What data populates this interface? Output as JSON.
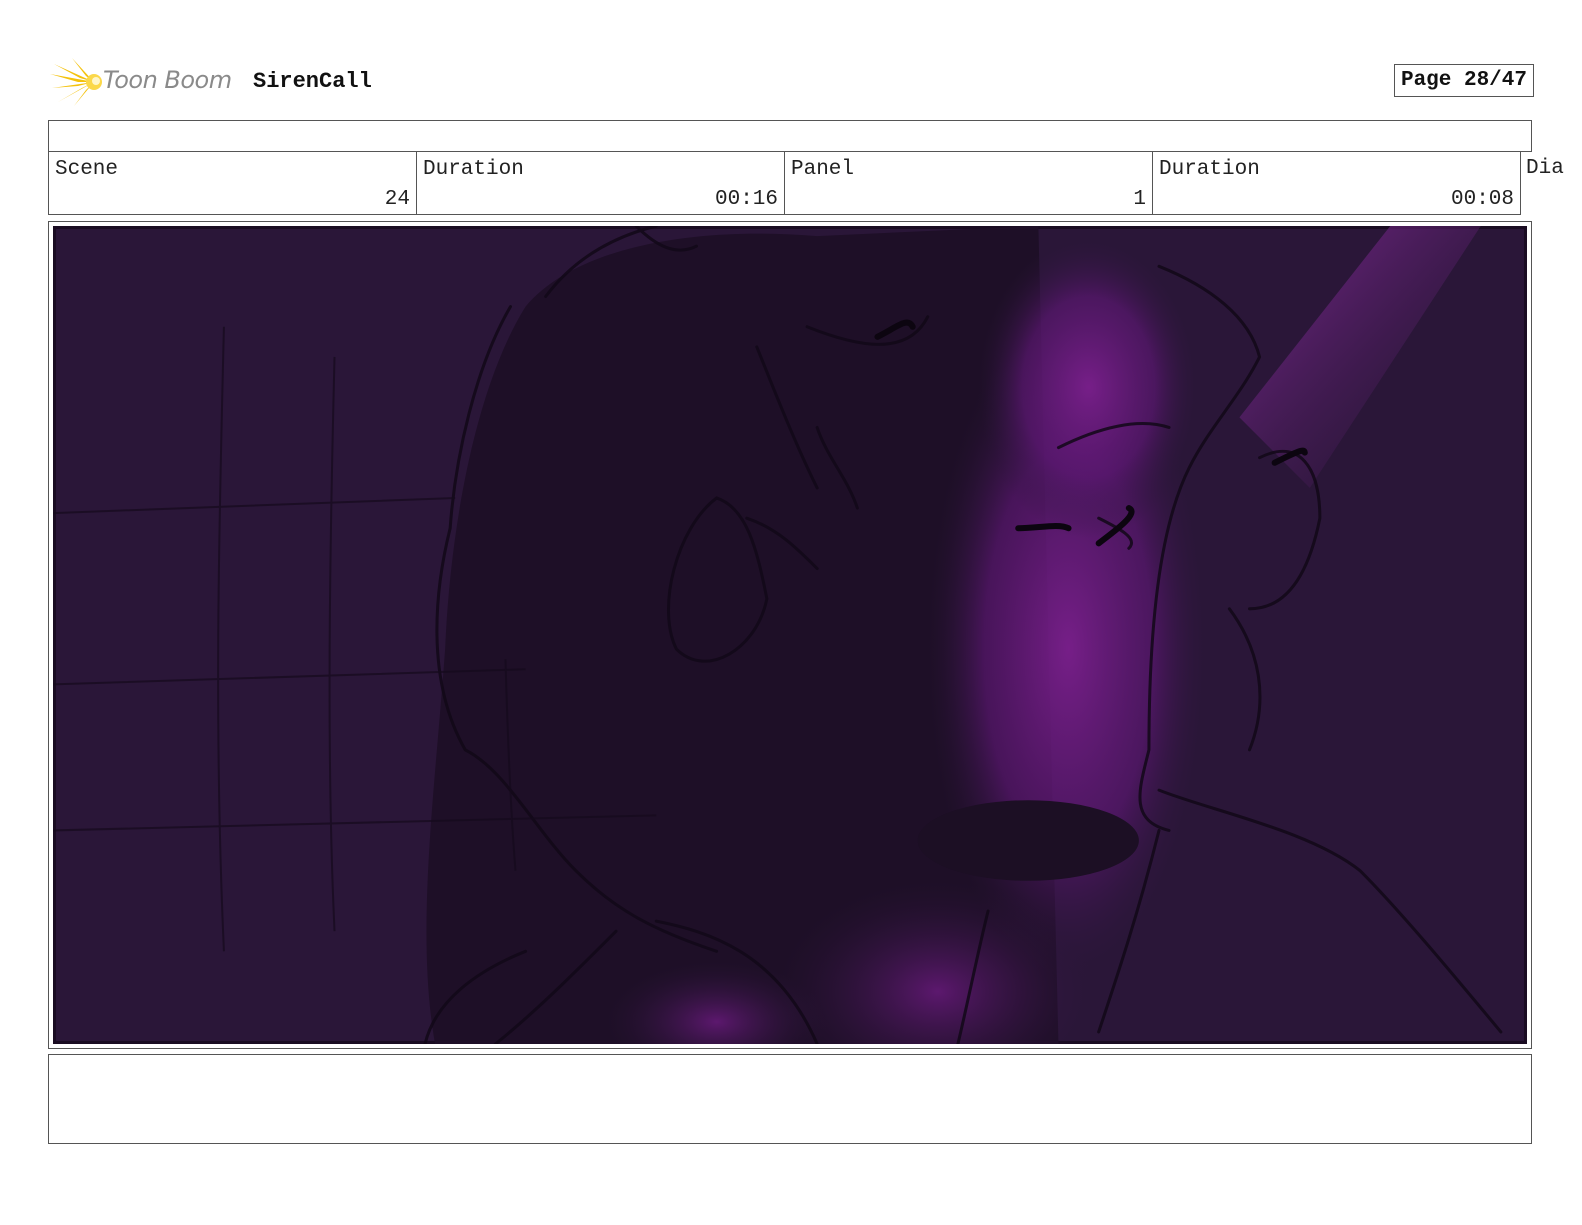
{
  "header": {
    "brand": "Toon Boom",
    "project": "SirenCall",
    "page": "Page 28/47"
  },
  "info": {
    "scene_label": "Scene",
    "scene_value": "24",
    "scene_duration_label": "Duration",
    "scene_duration_value": "00:16",
    "panel_label": "Panel",
    "panel_value": "1",
    "panel_duration_label": "Duration",
    "panel_duration_value": "00:08",
    "dialogue_label": "Dia"
  },
  "panel_image": {
    "icon": "storyboard-sketch",
    "colors": {
      "background": "#2a1638",
      "highlight": "#7a1f8c",
      "shadow": "#1c0f24",
      "line": "#120818"
    }
  },
  "notes": {
    "text": ""
  }
}
